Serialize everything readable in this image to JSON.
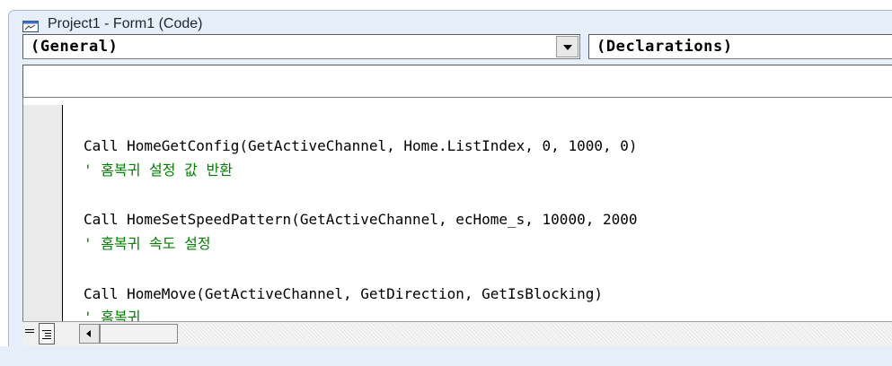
{
  "window": {
    "title": "Project1 - Form1 (Code)"
  },
  "object_combo": {
    "value": "(General)"
  },
  "procedure_combo": {
    "value": "(Declarations)"
  },
  "code": {
    "lines": [
      {
        "text": "Call HomeGetConfig(GetActiveChannel, Home.ListIndex, 0, 1000, 0)",
        "kind": "code"
      },
      {
        "text": "' 홈복귀 설정 값 반환",
        "kind": "comment"
      },
      {
        "text": "Call HomeSetSpeedPattern(GetActiveChannel, ecHome_s, 10000, 2000",
        "kind": "code"
      },
      {
        "text": "' 홈복귀 속도 설정",
        "kind": "comment"
      },
      {
        "text": "Call HomeMove(GetActiveChannel, GetDirection, GetIsBlocking)",
        "kind": "code"
      },
      {
        "text": "' 홈복귀",
        "kind": "comment"
      }
    ]
  },
  "colors": {
    "comment": "#008000",
    "code": "#000000",
    "window_bg": "#e6eef9"
  }
}
